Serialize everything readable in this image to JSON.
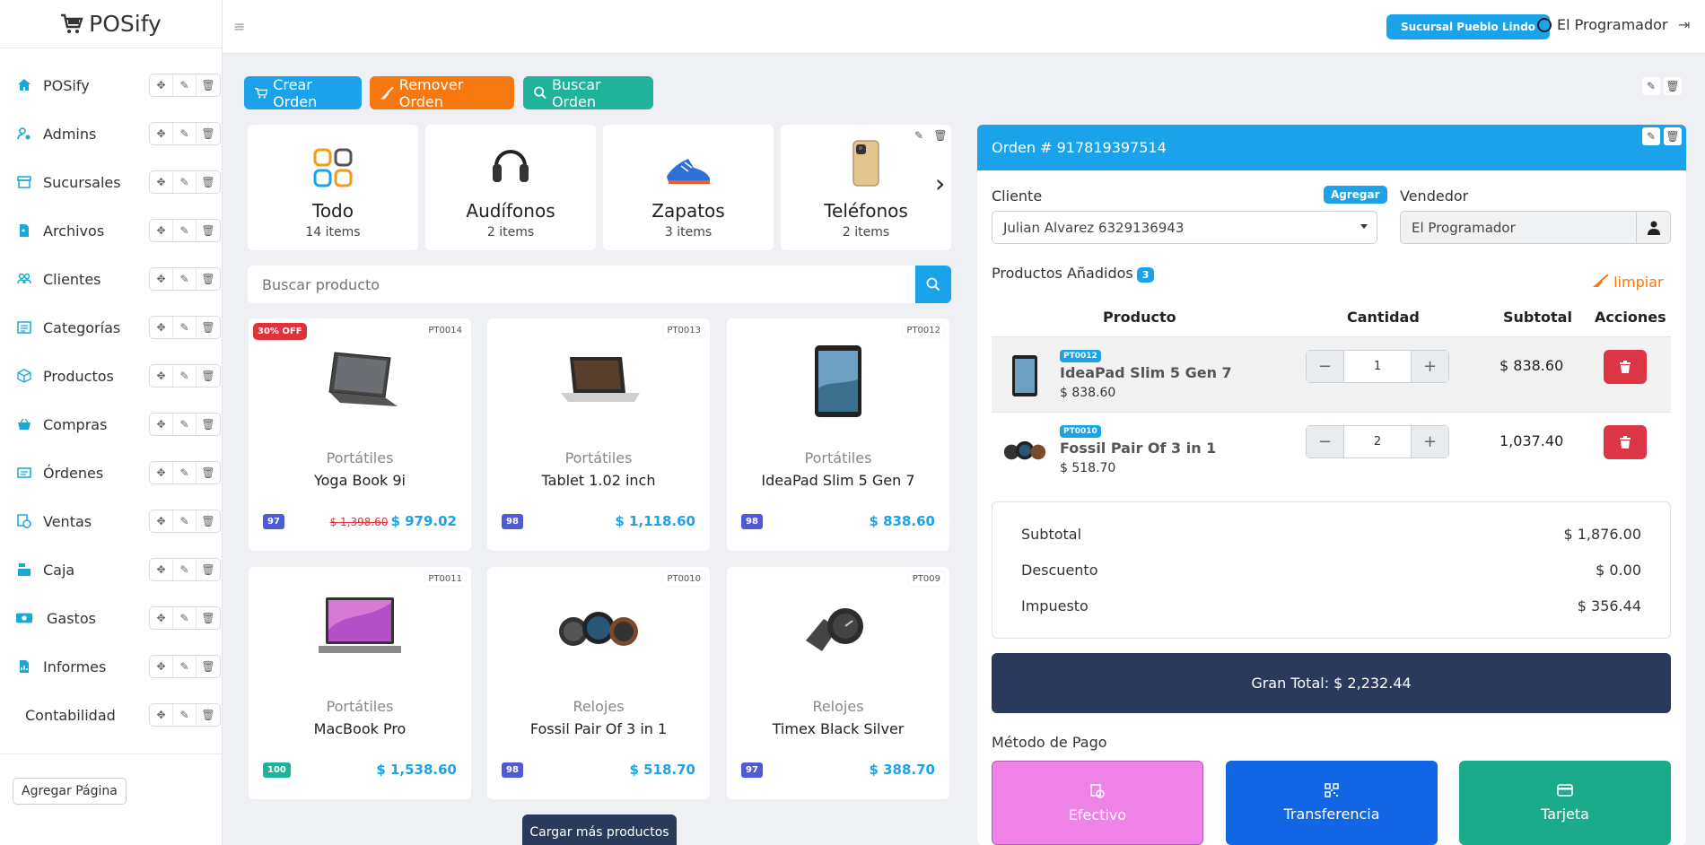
{
  "brand": {
    "name": "POSify"
  },
  "sidebar": {
    "items": [
      {
        "label": "POSify",
        "icon": "home-icon"
      },
      {
        "label": "Admins",
        "icon": "user-gear-icon"
      },
      {
        "label": "Sucursales",
        "icon": "store-icon"
      },
      {
        "label": "Archivos",
        "icon": "file-image-icon"
      },
      {
        "label": "Clientes",
        "icon": "users-icon"
      },
      {
        "label": "Categorías",
        "icon": "list-icon"
      },
      {
        "label": "Productos",
        "icon": "box-icon"
      },
      {
        "label": "Compras",
        "icon": "basket-icon"
      },
      {
        "label": "Órdenes",
        "icon": "receipt-icon"
      },
      {
        "label": "Ventas",
        "icon": "sales-icon"
      },
      {
        "label": "Caja",
        "icon": "cash-register-icon"
      },
      {
        "label": "Gastos",
        "icon": "money-icon"
      },
      {
        "label": "Informes",
        "icon": "report-icon"
      },
      {
        "label": "Contabilidad",
        "icon": ""
      }
    ],
    "add_page": "Agregar Página"
  },
  "topbar": {
    "branch": "Sucursal Pueblo Lindo",
    "user": "El Programador"
  },
  "actions": {
    "create": "Crear Orden",
    "remove": "Remover Orden",
    "search": "Buscar Orden"
  },
  "categories": [
    {
      "name": "Todo",
      "count": "14 items"
    },
    {
      "name": "Audífonos",
      "count": "2 items"
    },
    {
      "name": "Zapatos",
      "count": "3 items"
    },
    {
      "name": "Teléfonos",
      "count": "2 items"
    }
  ],
  "search": {
    "placeholder": "Buscar producto"
  },
  "products": [
    {
      "code": "PT0014",
      "category": "Portátiles",
      "name": "Yoga Book 9i",
      "stock": "97",
      "old_price": "$ 1,398.60",
      "price": "$ 979.02",
      "badge": "30% OFF"
    },
    {
      "code": "PT0013",
      "category": "Portátiles",
      "name": "Tablet 1.02 inch",
      "stock": "98",
      "price": "$ 1,118.60"
    },
    {
      "code": "PT0012",
      "category": "Portátiles",
      "name": "IdeaPad Slim 5 Gen 7",
      "stock": "98",
      "price": "$ 838.60"
    },
    {
      "code": "PT0011",
      "category": "Portátiles",
      "name": "MacBook Pro",
      "stock": "100",
      "price": "$ 1,538.60"
    },
    {
      "code": "PT0010",
      "category": "Relojes",
      "name": "Fossil Pair Of 3 in 1",
      "stock": "98",
      "price": "$ 518.70"
    },
    {
      "code": "PT009",
      "category": "Relojes",
      "name": "Timex Black Silver",
      "stock": "97",
      "price": "$ 388.70"
    }
  ],
  "load_more": "Cargar más productos",
  "order": {
    "title": "Orden # 917819397514",
    "client_label": "Cliente",
    "add_label": "Agregar",
    "client_value": "Julian Alvarez 6329136943",
    "seller_label": "Vendedor",
    "seller_value": "El Programador",
    "products_label": "Productos Añadidos",
    "products_count": "3",
    "clear": "limpiar",
    "headers": {
      "product": "Producto",
      "qty": "Cantidad",
      "subtotal": "Subtotal",
      "actions": "Acciones"
    },
    "lines": [
      {
        "code": "PT0012",
        "name": "IdeaPad Slim 5 Gen 7",
        "unit": "$ 838.60",
        "qty": "1",
        "subtotal": "$ 838.60"
      },
      {
        "code": "PT0010",
        "name": "Fossil Pair Of 3 in 1",
        "unit": "$ 518.70",
        "qty": "2",
        "subtotal": "1,037.40"
      }
    ],
    "totals": {
      "subtotal_label": "Subtotal",
      "subtotal": "$ 1,876.00",
      "discount_label": "Descuento",
      "discount": "$ 0.00",
      "tax_label": "Impuesto",
      "tax": "$ 356.44"
    },
    "grand_total": "Gran Total: $ 2,232.44",
    "payment_label": "Método de Pago",
    "payment": {
      "cash": "Efectivo",
      "transfer": "Transferencia",
      "card": "Tarjeta"
    }
  },
  "colors": {
    "primary": "#1aa3ea",
    "orange": "#f7780f",
    "teal": "#1fb39a",
    "navy": "#2b3a5c",
    "danger": "#dc3545",
    "cash": "#ee82e6",
    "transfer": "#1166e5",
    "card": "#1aab8b"
  }
}
